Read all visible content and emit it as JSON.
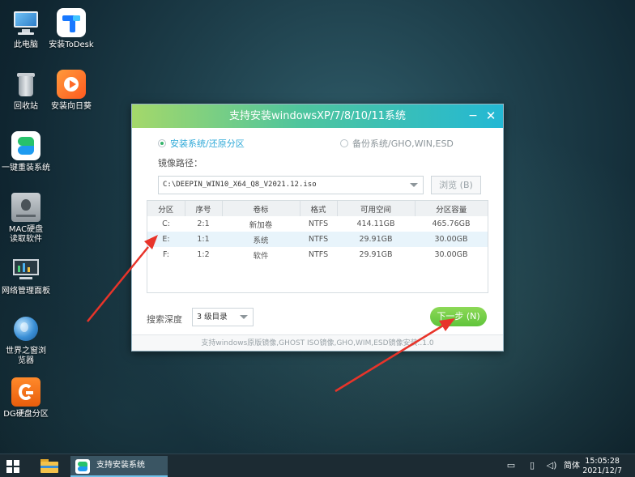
{
  "desktop": {
    "icons": [
      {
        "label": "此电脑",
        "icon": "computer-icon"
      },
      {
        "label": "安装ToDesk",
        "icon": "todesk-icon"
      },
      {
        "label": "回收站",
        "icon": "recycle-bin-icon"
      },
      {
        "label": "安装向日葵",
        "icon": "sunflower-icon"
      },
      {
        "label": "一键重装系统",
        "icon": "reinstall-icon"
      },
      {
        "label": "MAC硬盘读取软件",
        "icon": "mac-disk-icon"
      },
      {
        "label": "网络管理面板",
        "icon": "network-panel-icon"
      },
      {
        "label": "世界之窗浏览器",
        "icon": "browser-globe-icon"
      },
      {
        "label": "DG硬盘分区",
        "icon": "diskgenius-icon"
      }
    ]
  },
  "dialog": {
    "title": "支持安装windowsXP/7/8/10/11系统",
    "minimize_label": "−",
    "close_label": "✕",
    "radio_install": "安装系统/还原分区",
    "radio_backup": "备份系统/GHO,WIN,ESD",
    "selected_mode": "install",
    "image_path_label": "镜像路径：",
    "image_path_value": "C:\\DEEPIN_WIN10_X64_Q8_V2021.12.iso",
    "browse_label": "浏览 (B)",
    "table": {
      "headers": [
        "分区",
        "序号",
        "卷标",
        "格式",
        "可用空间",
        "分区容量"
      ],
      "rows": [
        [
          "C:",
          "2:1",
          "新加卷",
          "NTFS",
          "414.11GB",
          "465.76GB"
        ],
        [
          "E:",
          "1:1",
          "系统",
          "NTFS",
          "29.91GB",
          "30.00GB"
        ],
        [
          "F:",
          "1:2",
          "软件",
          "NTFS",
          "29.91GB",
          "30.00GB"
        ]
      ],
      "selected_row": 1
    },
    "search_depth_label": "搜索深度",
    "search_depth_value": "3 级目录",
    "next_label": "下一步 (N)",
    "footer": "支持windows原版镜像,GHOST ISO镜像,GHO,WIM,ESD镜像安装..1.0"
  },
  "taskbar": {
    "active_app": "支持安装系统",
    "ime": "简体",
    "time": "15:05:28",
    "date": "2021/12/7"
  },
  "colors": {
    "accent_green": "#5fc43b",
    "accent_blue": "#2fa9d8",
    "annotation_arrow": "#e8342a"
  }
}
